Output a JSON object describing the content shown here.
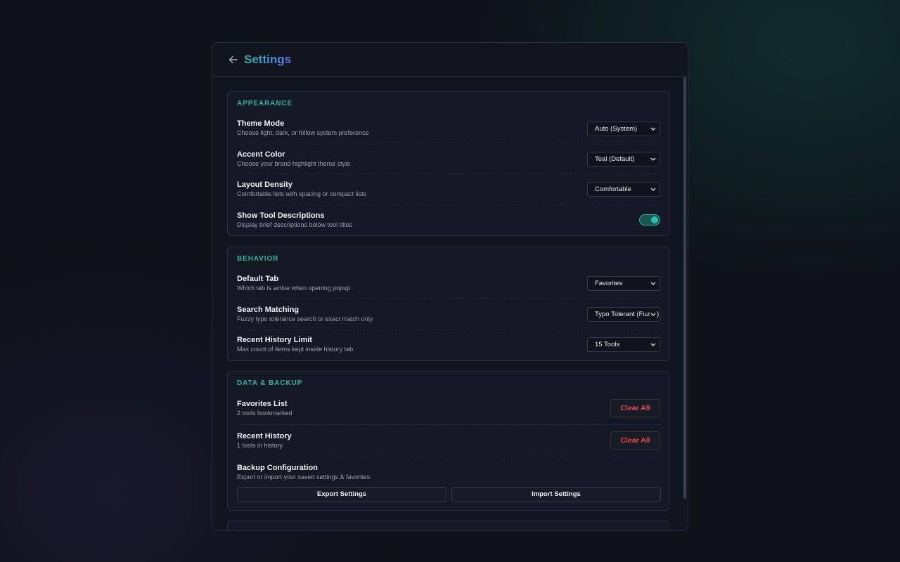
{
  "header": {
    "title": "Settings"
  },
  "appearance": {
    "title": "APPEARANCE",
    "theme_mode": {
      "label": "Theme Mode",
      "desc": "Choose light, dark, or follow system preference",
      "value": "Auto (System)"
    },
    "accent_color": {
      "label": "Accent Color",
      "desc": "Choose your brand highlight theme style",
      "value": "Teal (Default)"
    },
    "layout_density": {
      "label": "Layout Density",
      "desc": "Comfortable lists with spacing or compact lists",
      "value": "Comfortable"
    },
    "show_descriptions": {
      "label": "Show Tool Descriptions",
      "desc": "Display brief descriptions below tool titles",
      "enabled": true
    }
  },
  "behavior": {
    "title": "BEHAVIOR",
    "default_tab": {
      "label": "Default Tab",
      "desc": "Which tab is active when opening popup",
      "value": "Favorites"
    },
    "search_matching": {
      "label": "Search Matching",
      "desc": "Fuzzy typo tolerance search or exact match only",
      "value": "Typo Tolerant (Fuzzy)"
    },
    "history_limit": {
      "label": "Recent History Limit",
      "desc": "Max count of items kept inside history tab",
      "value": "15 Tools"
    }
  },
  "data_backup": {
    "title": "DATA & BACKUP",
    "favorites": {
      "label": "Favorites List",
      "desc": "2 tools bookmarked",
      "button": "Clear All"
    },
    "history": {
      "label": "Recent History",
      "desc": "1 tools in history",
      "button": "Clear All"
    },
    "backup": {
      "label": "Backup Configuration",
      "desc": "Export or import your saved settings & favorites",
      "export_button": "Export Settings",
      "import_button": "Import Settings"
    }
  },
  "colors": {
    "accent": "#2bb3a3",
    "danger": "#ef4a4a",
    "panel": "#111520"
  },
  "icons": {
    "back": "arrow-left-icon",
    "select": "chevron-down-icon"
  }
}
